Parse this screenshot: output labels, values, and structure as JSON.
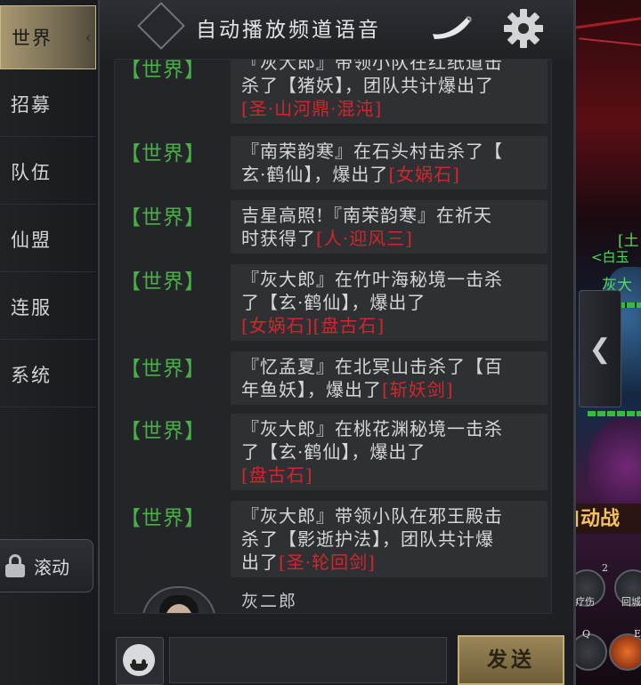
{
  "sidebar": {
    "tabs": [
      {
        "label": "世界",
        "active": true
      },
      {
        "label": "招募",
        "active": false
      },
      {
        "label": "队伍",
        "active": false
      },
      {
        "label": "仙盟",
        "active": false
      },
      {
        "label": "连服",
        "active": false
      },
      {
        "label": "系统",
        "active": false
      }
    ],
    "scroll_label": "滚动"
  },
  "header": {
    "title": "自动播放频道语音",
    "icons": [
      "horn-icon",
      "gear-icon"
    ]
  },
  "messages": [
    {
      "channel": "【世界】",
      "line1": "『灰大郎』带领小队在红纸道击",
      "line2a": "杀了【猪妖】，团队共计爆出了",
      "line3": "[圣·山河鼎·混沌]"
    },
    {
      "channel": "【世界】",
      "line1": "『南荣韵寒』在石头村击杀了【",
      "line2a": "玄·鹤仙】，爆出了",
      "red": "[女娲石]"
    },
    {
      "channel": "【世界】",
      "line1": "吉星高照!『南荣韵寒』在祈天",
      "line2a": "时获得了",
      "red": "[人·迎风三]"
    },
    {
      "channel": "【世界】",
      "line1": "『灰大郎』在竹叶海秘境一击杀",
      "line2a": "了【玄·鹤仙】，爆出了",
      "line3": "[女娲石][盘古石]"
    },
    {
      "channel": "【世界】",
      "line1": "『忆孟夏』在北冥山击杀了【百",
      "line2a": "年鱼妖】，爆出了",
      "red": "[斩妖剑]"
    },
    {
      "channel": "【世界】",
      "line1": "『灰大郎』在桃花渊秘境一击杀",
      "line2a": "了【玄·鹤仙】，爆出了",
      "line3": "[盘古石]"
    },
    {
      "channel": "【世界】",
      "line1": "『灰大郎』带领小队在邪王殿击",
      "line2a": "杀了【影逝护法】，团队共计爆",
      "line3a": "出了",
      "red": "[圣·轮回剑]"
    }
  ],
  "last_sender": "灰二郎",
  "input": {
    "value": "",
    "placeholder": ""
  },
  "send_label": "发送",
  "game": {
    "auto_battle": "自动战",
    "name_fragments": [
      "[土",
      "<白玉",
      "灰大"
    ],
    "skill_numbers": [
      "2",
      "Q",
      "E"
    ],
    "skill_labels": [
      "疗伤",
      "回城"
    ]
  },
  "colors": {
    "channel": "#48b047",
    "item": "#d3262c",
    "active_tab": "#a89870",
    "send": "#9a8658"
  }
}
